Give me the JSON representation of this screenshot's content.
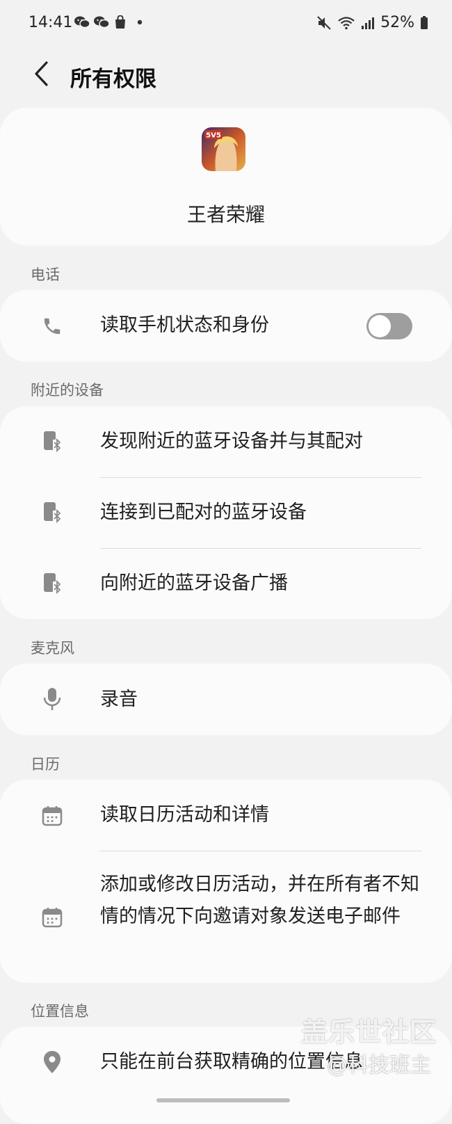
{
  "status_bar": {
    "time": "14:41",
    "battery": "52%",
    "left_icons": [
      "wechat-icon",
      "wechat-icon",
      "shopping-bag-icon",
      "dot-icon"
    ],
    "right_icons": [
      "mute-icon",
      "wifi-icon",
      "signal-icon",
      "battery-icon"
    ]
  },
  "header": {
    "title": "所有权限",
    "back_icon": "back-arrow-icon"
  },
  "app": {
    "name": "王者荣耀",
    "icon_badge": "5V5"
  },
  "sections": {
    "phone": {
      "label": "电话",
      "items": [
        {
          "text": "读取手机状态和身份",
          "icon": "phone-icon",
          "toggle_on": false
        }
      ]
    },
    "nearby": {
      "label": "附近的设备",
      "items": [
        {
          "text": "发现附近的蓝牙设备并与其配对",
          "icon": "bluetooth-device-icon"
        },
        {
          "text": "连接到已配对的蓝牙设备",
          "icon": "bluetooth-device-icon"
        },
        {
          "text": "向附近的蓝牙设备广播",
          "icon": "bluetooth-device-icon"
        }
      ]
    },
    "microphone": {
      "label": "麦克风",
      "items": [
        {
          "text": "录音",
          "icon": "microphone-icon"
        }
      ]
    },
    "calendar": {
      "label": "日历",
      "items": [
        {
          "text": "读取日历活动和详情",
          "icon": "calendar-icon"
        },
        {
          "text": "添加或修改日历活动，并在所有者不知情的情况下向邀请对象发送电子邮件",
          "icon": "calendar-icon"
        }
      ]
    },
    "location": {
      "label": "位置信息",
      "items": [
        {
          "text": "只能在前台获取精确的位置信息",
          "icon": "location-pin-icon"
        }
      ]
    }
  },
  "watermark": {
    "line1": "盖乐世社区",
    "line2": "@科技班主"
  },
  "colors": {
    "background": "#f2f2f2",
    "card": "#fbfbfb",
    "icon_gray": "#8a8a8a",
    "toggle_off": "#9e9e9e"
  }
}
